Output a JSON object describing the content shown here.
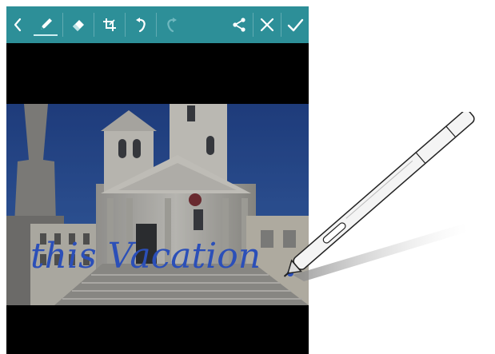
{
  "toolbar": {
    "items": [
      {
        "name": "back-icon",
        "active": false,
        "enabled": true
      },
      {
        "name": "pen-icon",
        "active": true,
        "enabled": true
      },
      {
        "name": "eraser-icon",
        "active": false,
        "enabled": true
      },
      {
        "name": "crop-icon",
        "active": false,
        "enabled": true
      },
      {
        "name": "undo-icon",
        "active": false,
        "enabled": true
      },
      {
        "name": "redo-icon",
        "active": false,
        "enabled": false
      },
      {
        "name": "share-icon",
        "active": false,
        "enabled": true
      },
      {
        "name": "close-icon",
        "active": false,
        "enabled": true
      },
      {
        "name": "done-icon",
        "active": false,
        "enabled": true
      }
    ],
    "color": "#2d8f98"
  },
  "photo": {
    "handwriting": "this Vacation",
    "ink_color": "#2b4fb8"
  }
}
